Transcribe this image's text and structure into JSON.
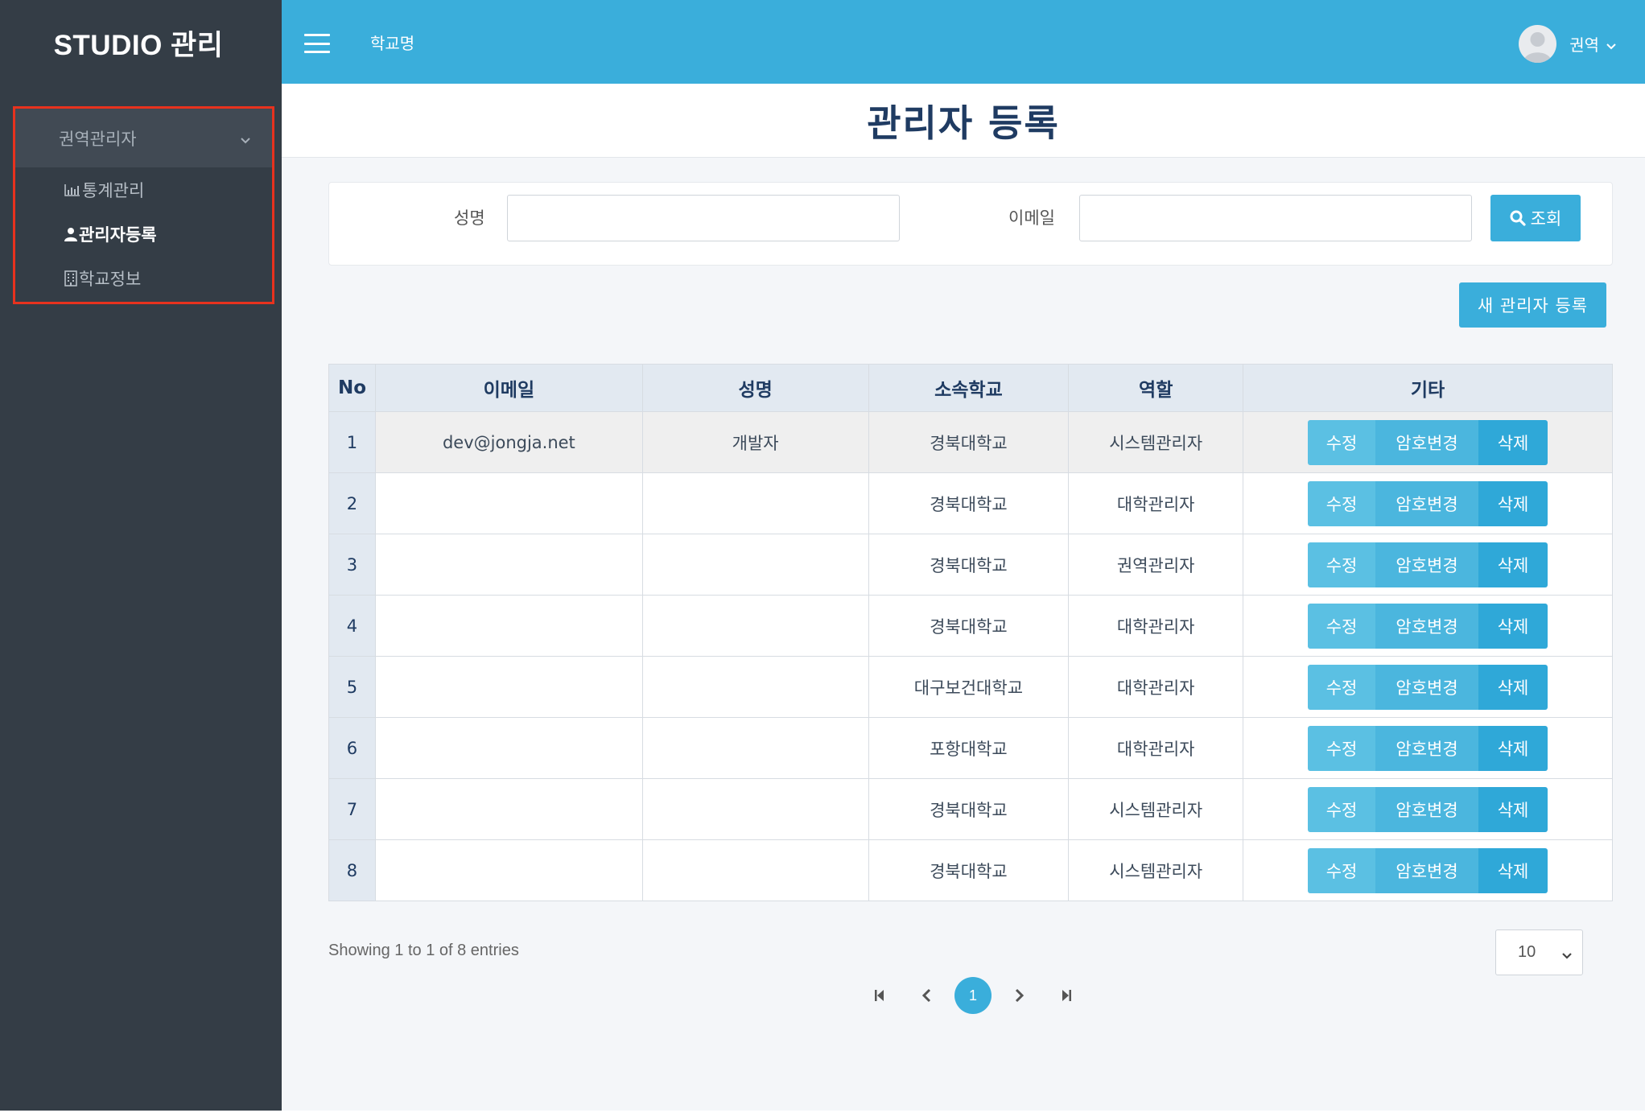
{
  "app": {
    "brand": "STUDIO 관리"
  },
  "sidebar": {
    "group_label": "권역관리자",
    "items": [
      {
        "label": "통계관리",
        "icon": "bar-chart-icon",
        "active": false
      },
      {
        "label": "관리자등록",
        "icon": "user-icon",
        "active": true
      },
      {
        "label": "학교정보",
        "icon": "building-icon",
        "active": false
      }
    ]
  },
  "topbar": {
    "school_name": "학교명",
    "user_name": "권역"
  },
  "page": {
    "title": "관리자 등록"
  },
  "search": {
    "name_label": "성명",
    "name_value": "",
    "email_label": "이메일",
    "email_value": "",
    "button_label": "조회"
  },
  "toolbar": {
    "new_admin_label": "새 관리자 등록"
  },
  "table": {
    "columns": [
      "No",
      "이메일",
      "성명",
      "소속학교",
      "역할",
      "기타"
    ],
    "action_labels": {
      "edit": "수정",
      "password": "암호변경",
      "delete": "삭제"
    },
    "rows": [
      {
        "no": "1",
        "email": "dev@jongja.net",
        "name": "개발자",
        "school": "경북대학교",
        "role": "시스템관리자"
      },
      {
        "no": "2",
        "email": "",
        "name": "",
        "school": "경북대학교",
        "role": "대학관리자"
      },
      {
        "no": "3",
        "email": "",
        "name": "",
        "school": "경북대학교",
        "role": "권역관리자"
      },
      {
        "no": "4",
        "email": "",
        "name": "",
        "school": "경북대학교",
        "role": "대학관리자"
      },
      {
        "no": "5",
        "email": "",
        "name": "",
        "school": "대구보건대학교",
        "role": "대학관리자"
      },
      {
        "no": "6",
        "email": "",
        "name": "",
        "school": "포항대학교",
        "role": "대학관리자"
      },
      {
        "no": "7",
        "email": "",
        "name": "",
        "school": "경북대학교",
        "role": "시스템관리자"
      },
      {
        "no": "8",
        "email": "",
        "name": "",
        "school": "경북대학교",
        "role": "시스템관리자"
      }
    ]
  },
  "footer": {
    "info": "Showing 1 to 1 of 8 entries",
    "page_size": "10",
    "current_page": "1"
  },
  "colors": {
    "sidebar_bg": "#343d46",
    "topbar_bg": "#3aaedb",
    "accent": "#3aaedb",
    "highlight_border": "#e8321e",
    "title_color": "#1f3b62"
  }
}
